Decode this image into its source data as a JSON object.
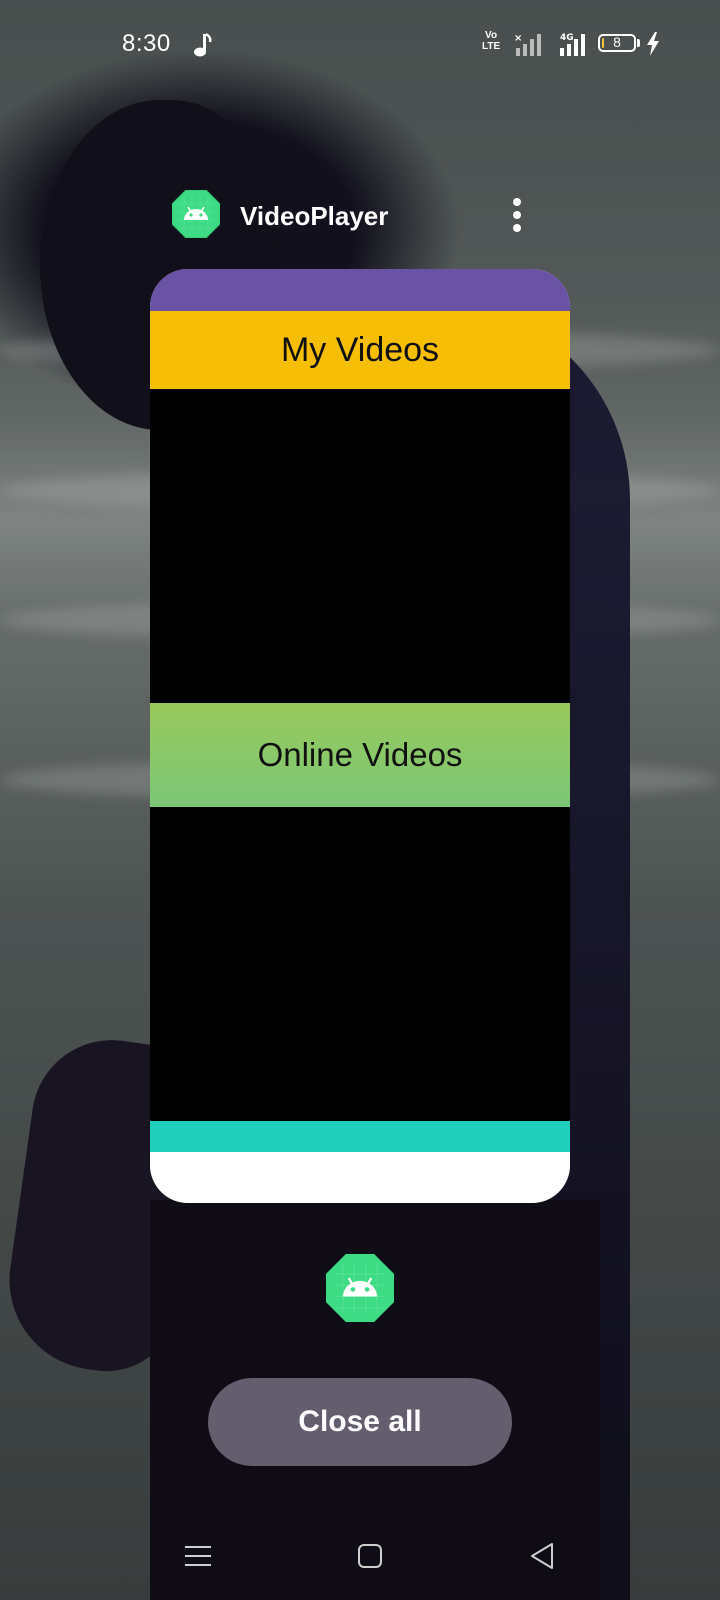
{
  "status_bar": {
    "time": "8:30",
    "network_label": "Vo\nLTE",
    "network_tag": "4G",
    "battery_level": "8",
    "battery_level_fraction": 0.08,
    "icons": [
      "music-note-icon",
      "volte-icon",
      "signal-icon",
      "battery-icon",
      "charging-icon"
    ]
  },
  "recent_app": {
    "title": "VideoPlayer",
    "icon": "android-app-icon",
    "menu_icon": "more-vert-icon"
  },
  "app_preview": {
    "section_1_title": "My Videos",
    "section_2_title": "Online Videos",
    "colors": {
      "top_bar": "#6a52a5",
      "my_videos_header": "#f6bf06",
      "online_videos_header": "#8cc866",
      "bottom_bar": "#21cfbd",
      "video_area": "#000000"
    }
  },
  "actions": {
    "close_all_label": "Close all"
  },
  "nav_bar": {
    "icons": [
      "menu-icon",
      "home-icon",
      "back-icon"
    ]
  }
}
